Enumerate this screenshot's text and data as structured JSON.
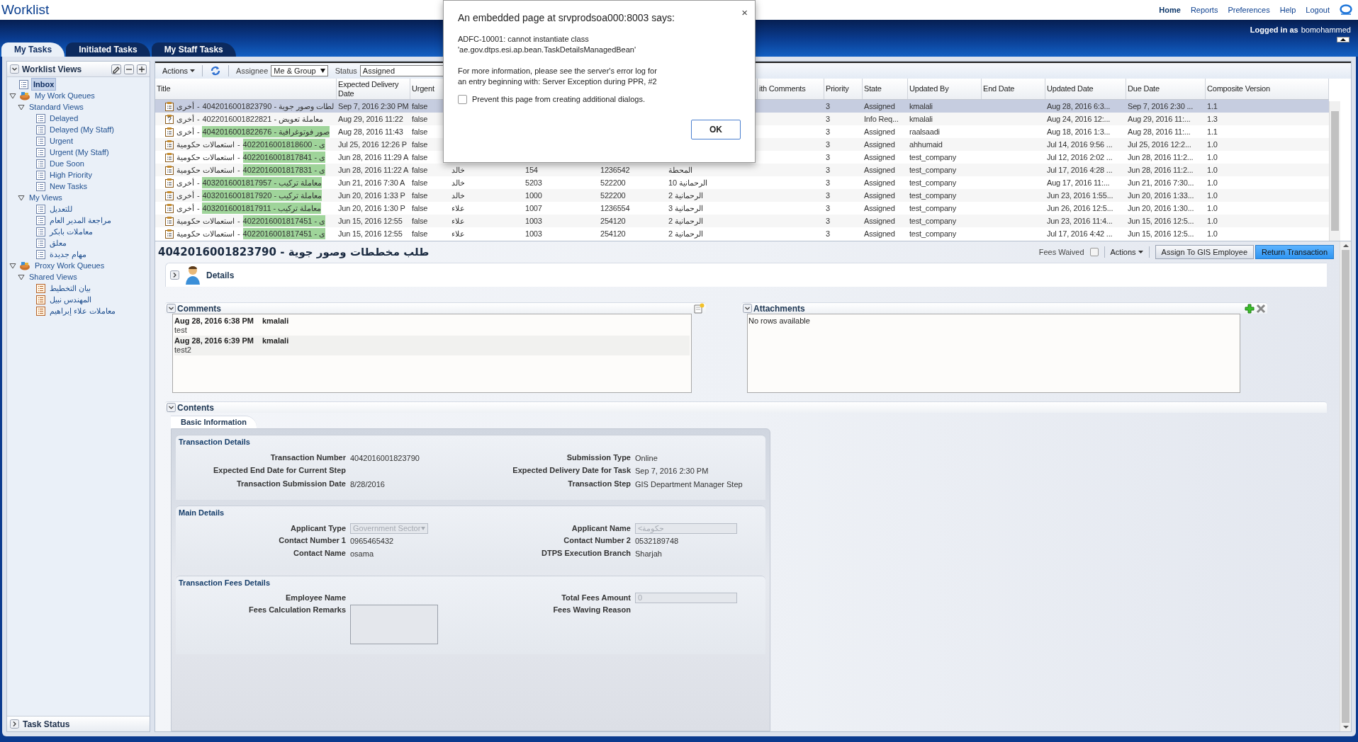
{
  "header": {
    "title": "Worklist",
    "links": [
      {
        "label": "Home",
        "selected": true
      },
      {
        "label": "Reports",
        "selected": false
      },
      {
        "label": "Preferences",
        "selected": false
      },
      {
        "label": "Help",
        "selected": false
      },
      {
        "label": "Logout",
        "selected": false
      }
    ],
    "logged_in_label": "Logged in as",
    "user": "bomohammed"
  },
  "tabs": [
    {
      "label": "My Tasks",
      "selected": true
    },
    {
      "label": "Initiated Tasks",
      "selected": false
    },
    {
      "label": "My Staff Tasks",
      "selected": false
    }
  ],
  "sidebar": {
    "title": "Worklist Views",
    "tree": [
      {
        "label": "Inbox",
        "kind": "list",
        "selected": true
      },
      {
        "label": "My Work Queues",
        "kind": "queue",
        "selected": false,
        "expanded": true,
        "children": [
          {
            "label": "Standard Views",
            "selected": false,
            "expanded": true,
            "children": [
              {
                "label": "Delayed",
                "kind": "list",
                "selected": false
              },
              {
                "label": "Delayed (My Staff)",
                "kind": "list",
                "selected": false
              },
              {
                "label": "Urgent",
                "kind": "list",
                "selected": false
              },
              {
                "label": "Urgent (My Staff)",
                "kind": "list",
                "selected": false
              },
              {
                "label": "Due Soon",
                "kind": "list",
                "selected": false
              },
              {
                "label": "High Priority",
                "kind": "list",
                "selected": false
              },
              {
                "label": "New Tasks",
                "kind": "list",
                "selected": false
              }
            ]
          },
          {
            "label": "My Views",
            "selected": false,
            "expanded": true,
            "children": [
              {
                "label": "للتعديل",
                "kind": "list",
                "selected": false
              },
              {
                "label": "مراجعة المدير العام",
                "kind": "list",
                "selected": false
              },
              {
                "label": "معاملات بابكر",
                "kind": "list",
                "selected": false
              },
              {
                "label": "معلق",
                "kind": "list",
                "selected": false
              },
              {
                "label": "مهام جديدة",
                "kind": "list",
                "selected": false
              }
            ]
          }
        ]
      },
      {
        "label": "Proxy Work Queues",
        "kind": "queue",
        "selected": false,
        "expanded": true,
        "children": [
          {
            "label": "Shared Views",
            "selected": false,
            "expanded": true,
            "children": [
              {
                "label": "بيان التخطيط",
                "kind": "shared",
                "selected": false
              },
              {
                "label": "المهندس نبيل",
                "kind": "shared",
                "selected": false
              },
              {
                "label": "معاملات علاء إبراهيم",
                "kind": "shared",
                "selected": false
              }
            ]
          }
        ]
      }
    ],
    "footer": "Task Status"
  },
  "toolbar": {
    "actions": "Actions",
    "assignee_label": "Assignee",
    "assignee": "Me & Group",
    "status_label": "Status",
    "status": "Assigned"
  },
  "table": {
    "columns": {
      "title": "Title",
      "expected_delivery_date": "Expected Delivery Date",
      "urgent": "Urgent",
      "with_comments": "ith Comments",
      "priority": "Priority",
      "state": "State",
      "updated_by": "Updated By",
      "end_date": "End Date",
      "updated_date": "Updated Date",
      "due_date": "Due Date",
      "composite_version": "Composite Version"
    },
    "rows": [
      {
        "selected": true,
        "kind": "task",
        "title": {
          "category": "أخرى",
          "separator": "-",
          "text": "4042016001823790 - لطات وصور جوية",
          "highlighted": false
        },
        "expected_delivery_date": "Sep 7, 2016 2:30 PM",
        "urgent": "false",
        "priority": "3",
        "state": "Assigned",
        "updated_by": "kmalali",
        "updated_date": "Aug 28, 2016 6:3...",
        "due_date": "Sep 7, 2016 2:30 ...",
        "composite_version": "1.1"
      },
      {
        "selected": false,
        "kind": "query",
        "title": {
          "category": "أخرى",
          "separator": "-",
          "text": "4022016001822821 - معاملة تعويض",
          "highlighted": false
        },
        "expected_delivery_date": "Aug 29, 2016 11:22",
        "urgent": "false",
        "priority": "3",
        "state": "Info Req...",
        "updated_by": "kmalali",
        "updated_date": "Aug 24, 2016 12:...",
        "due_date": "Aug 29, 2016 11:...",
        "composite_version": "1.3"
      },
      {
        "selected": false,
        "kind": "task",
        "title": {
          "category": "أخرى",
          "separator": "-",
          "text": "4042016001822676 - صور فوتوغرافية",
          "highlighted": true
        },
        "expected_delivery_date": "Aug 28, 2016 11:43",
        "urgent": "false",
        "priority": "3",
        "state": "Assigned",
        "updated_by": "raalsaadi",
        "updated_date": "Aug 18, 2016 1:3...",
        "due_date": "Aug 28, 2016 11:...",
        "composite_version": "1.1"
      },
      {
        "selected": false,
        "kind": "task",
        "title": {
          "category": "استعمالات حكومية",
          "separator": "-",
          "text": "4022016001818600 - ى",
          "highlighted": true
        },
        "expected_delivery_date": "Jul 25, 2016 12:26 P",
        "urgent": "false",
        "priority": "3",
        "state": "Assigned",
        "updated_by": "ahhumaid",
        "updated_date": "Jul 14, 2016 9:56 ...",
        "due_date": "Jul 25, 2016 12:2...",
        "composite_version": "1.0"
      },
      {
        "selected": false,
        "kind": "task",
        "title": {
          "category": "استعمالات حكومية",
          "separator": "-",
          "text": "4022016001817841 - ى",
          "highlighted": true
        },
        "expected_delivery_date": "Jun 28, 2016 11:29 A",
        "urgent": "false",
        "priority": "3",
        "state": "Assigned",
        "updated_by": "test_company",
        "updated_date": "Jul 12, 2016 2:02 ...",
        "due_date": "Jun 28, 2016 11:2...",
        "composite_version": "1.0"
      },
      {
        "selected": false,
        "kind": "task",
        "title": {
          "category": "استعمالات حكومية",
          "separator": "-",
          "text": "4022016001817831 - ى",
          "highlighted": true
        },
        "expected_delivery_date": "Jun 28, 2016 11:22 A",
        "urgent": "false",
        "column_4": "خالد",
        "column_5": "154",
        "column_6": "1236542",
        "column_7": "المحطة",
        "priority": "3",
        "state": "Assigned",
        "updated_by": "test_company",
        "updated_date": "Jul 17, 2016 4:28 ...",
        "due_date": "Jun 28, 2016 11:2...",
        "composite_version": "1.0"
      },
      {
        "selected": false,
        "kind": "task",
        "title": {
          "category": "أخرى",
          "separator": "-",
          "text": "4032016001817957 - معاملة تركيب",
          "highlighted": true
        },
        "expected_delivery_date": "Jun 21, 2016 7:30 A",
        "urgent": "false",
        "column_4": "خالد",
        "column_5": "5203",
        "column_6": "522200",
        "column_7": "الرحمانية 10",
        "priority": "3",
        "state": "Assigned",
        "updated_by": "test_company",
        "updated_date": "Aug 17, 2016 11:...",
        "due_date": "Jun 21, 2016 7:30...",
        "composite_version": "1.0"
      },
      {
        "selected": false,
        "kind": "task",
        "title": {
          "category": "أخرى",
          "separator": "-",
          "text": "4032016001817920 - معاملة تركيب",
          "highlighted": true
        },
        "expected_delivery_date": "Jun 20, 2016 1:33 P",
        "urgent": "false",
        "column_4": "خالد",
        "column_5": "1000",
        "column_6": "522200",
        "column_7": "الرحمانية 2",
        "priority": "3",
        "state": "Assigned",
        "updated_by": "test_company",
        "updated_date": "Jun 23, 2016 1:55...",
        "due_date": "Jun 20, 2016 1:33...",
        "composite_version": "1.0"
      },
      {
        "selected": false,
        "kind": "task",
        "title": {
          "category": "أخرى",
          "separator": "-",
          "text": "4032016001817911 - معاملة تركيب",
          "highlighted": true
        },
        "expected_delivery_date": "Jun 20, 2016 1:30 P",
        "urgent": "false",
        "column_4": "علاء",
        "column_5": "1007",
        "column_6": "1236554",
        "column_7": "الرحمانية 3",
        "priority": "3",
        "state": "Assigned",
        "updated_by": "test_company",
        "updated_date": "Jun 26, 2016 12:5...",
        "due_date": "Jun 20, 2016 1:30...",
        "composite_version": "1.0"
      },
      {
        "selected": false,
        "kind": "task",
        "title": {
          "category": "استعمالات حكومية",
          "separator": "-",
          "text": "4022016001817451 - ى",
          "highlighted": true
        },
        "expected_delivery_date": "Jun 15, 2016 12:55",
        "urgent": "false",
        "column_4": "علاء",
        "column_5": "1003",
        "column_6": "254120",
        "column_7": "الرحمانية 2",
        "priority": "3",
        "state": "Assigned",
        "updated_by": "test_company",
        "updated_date": "Jun 23, 2016 11:4...",
        "due_date": "Jun 15, 2016 12:5...",
        "composite_version": "1.0"
      },
      {
        "selected": false,
        "kind": "task",
        "title": {
          "category": "استعمالات حكومية",
          "separator": "-",
          "text": "4022016001817451 - ى",
          "highlighted": true
        },
        "expected_delivery_date": "Jun 15, 2016 12:55",
        "urgent": "false",
        "column_4": "علاء",
        "column_5": "1003",
        "column_6": "254120",
        "column_7": "الرحمانية 2",
        "priority": "3",
        "state": "Assigned",
        "updated_by": "test_company",
        "updated_date": "Jul 17, 2016 4:42 ...",
        "due_date": "Jun 15, 2016 12:5...",
        "composite_version": "1.0"
      }
    ]
  },
  "detail": {
    "title": "4042016001823790 - طلب مخططات وصور جوية",
    "fees_waived": {
      "label": "Fees Waived",
      "checked": false
    },
    "actions": "Actions",
    "buttons": [
      {
        "label": "Assign To GIS Employee",
        "primary": false
      },
      {
        "label": "Return Transaction",
        "primary": true
      }
    ],
    "details_label": "Details",
    "comments": {
      "title": "Comments",
      "items": [
        {
          "date": "Aug 28, 2016 6:38 PM",
          "user": "kmalali",
          "text": "test"
        },
        {
          "date": "Aug 28, 2016 6:39 PM",
          "user": "kmalali",
          "text": "test2"
        }
      ]
    },
    "attachments": {
      "title": "Attachments",
      "empty_text": "No rows available"
    },
    "contents": {
      "title": "Contents",
      "tab": "Basic Information",
      "sections": [
        {
          "title": "Transaction Details",
          "rows": [
            [
              {
                "label": "Transaction Number",
                "kind": "text",
                "value": "4042016001823790"
              },
              {
                "label": "Submission Type",
                "kind": "text",
                "value": "Online"
              }
            ],
            [
              {
                "label": "Expected End Date for Current Step",
                "kind": "text"
              },
              {
                "label": "Expected Delivery Date for Task",
                "kind": "text",
                "value": "Sep 7, 2016 2:30 PM"
              }
            ],
            [
              {
                "label": "Transaction Submission Date",
                "kind": "text",
                "value": "8/28/2016"
              },
              {
                "label": "Transaction Step",
                "kind": "text",
                "value": "GIS Department Manager Step"
              }
            ]
          ]
        },
        {
          "title": "Main Details",
          "rows": [
            [
              {
                "label": "Applicant Type",
                "kind": "select",
                "value": "Government Sector",
                "disabled": true
              },
              {
                "label": "Applicant Name",
                "kind": "input",
                "value": "<حكومة",
                "disabled": true
              }
            ],
            [
              {
                "label": "Contact Number 1",
                "kind": "text",
                "value": "0965465432"
              },
              {
                "label": "Contact Number 2",
                "kind": "text",
                "value": "0532189748"
              }
            ],
            [
              {
                "label": "Contact Name",
                "kind": "text",
                "value": "osama"
              },
              {
                "label": "DTPS Execution Branch",
                "kind": "text",
                "value": "Sharjah"
              }
            ]
          ]
        },
        {
          "title": "Transaction Fees Details",
          "rows": [
            [
              {
                "label": "Employee Name",
                "kind": "text"
              },
              {
                "label": "Total Fees Amount",
                "kind": "input",
                "value": "0",
                "disabled": true
              }
            ],
            [
              {
                "label": "Fees Calculation Remarks",
                "kind": "textarea"
              },
              {
                "label": "Fees Waving Reason",
                "kind": "text"
              }
            ]
          ]
        }
      ]
    }
  },
  "dialog": {
    "title": "An embedded page at srvprodsoa000:8003 says:",
    "close": "×",
    "message": [
      "ADFC-10001: cannot instantiate class",
      "'ae.gov.dtps.esi.ap.bean.TaskDetailsManagedBean'",
      "For more information, please see the server's error log for",
      "an entry beginning with: Server Exception during PPR, #2"
    ],
    "checkbox": {
      "label": "Prevent this page from creating additional dialogs.",
      "checked": false
    },
    "ok": "OK"
  }
}
